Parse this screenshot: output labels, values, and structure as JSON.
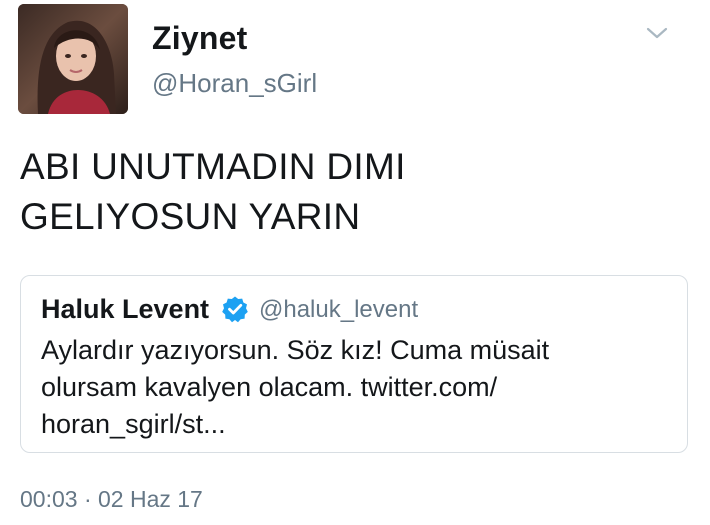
{
  "tweet": {
    "author": {
      "display_name": "Ziynet",
      "handle": "@Horan_sGirl",
      "avatar_icon": "profile-photo"
    },
    "menu_icon": "chevron-down-icon",
    "text_lines": [
      "ABI UNUTMADIN DIMI",
      "GELIYOSUN YARIN"
    ],
    "quoted": {
      "display_name": "Haluk Levent",
      "verified": true,
      "handle": "@haluk_levent",
      "text_lines": [
        "Aylardır yazıyorsun. Söz kız! Cuma müsait",
        "olursam kavalyen olacam. twitter.com/",
        "horan_sgirl/st..."
      ]
    },
    "timestamp": "00:03 · 02 Haz 17"
  },
  "colors": {
    "primary_text": "#14171a",
    "secondary_text": "#657786",
    "verified_badge": "#1da1f2",
    "card_border": "#d8dee3"
  }
}
